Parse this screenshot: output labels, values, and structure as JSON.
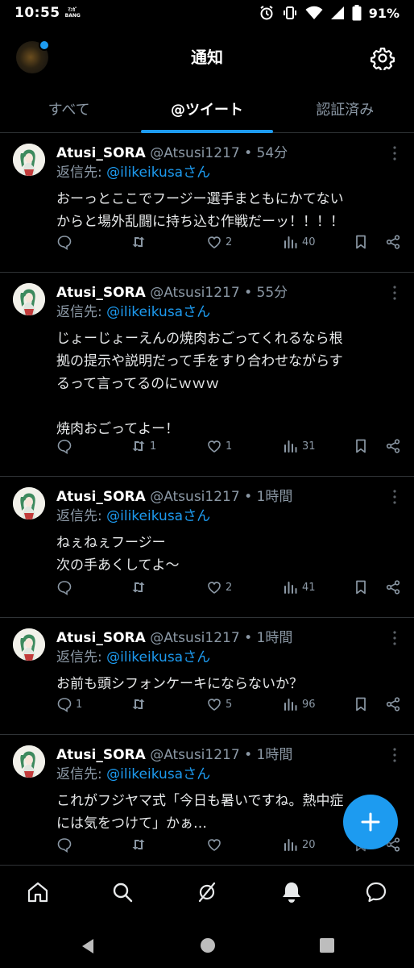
{
  "status_bar": {
    "time": "10:55",
    "carrier_line1": "ﾏﾝｶﾞ",
    "carrier_line2": "BANG",
    "battery": "91%"
  },
  "header": {
    "title": "通知"
  },
  "tabs": [
    {
      "label": "すべて",
      "active": false
    },
    {
      "label": "@ツイート",
      "active": true
    },
    {
      "label": "認証済み",
      "active": false
    }
  ],
  "tweets": [
    {
      "name": "Atusi_SORA",
      "handle": "@Atsusi1217",
      "sep": "•",
      "time": "54分",
      "reply_prefix": "返信先: ",
      "reply_to": "@ilikeikusaさん",
      "text": "おーっとここでフージー選手まともにかてない\nからと場外乱闘に持ち込む作戦だーッ！！！！",
      "replies": "",
      "retweets": "",
      "likes": "2",
      "views": "40"
    },
    {
      "name": "Atusi_SORA",
      "handle": "@Atsusi1217",
      "sep": "•",
      "time": "55分",
      "reply_prefix": "返信先: ",
      "reply_to": "@ilikeikusaさん",
      "text": "じょーじょーえんの焼肉おごってくれるなら根\n拠の提示や説明だって手をすり合わせながらす\nるって言ってるのにｗｗｗ\n\n焼肉おごってよー！",
      "replies": "",
      "retweets": "1",
      "likes": "1",
      "views": "31"
    },
    {
      "name": "Atusi_SORA",
      "handle": "@Atsusi1217",
      "sep": "•",
      "time": "1時間",
      "reply_prefix": "返信先: ",
      "reply_to": "@ilikeikusaさん",
      "text": "ねぇねぇフージー\n次の手あくしてよ〜",
      "replies": "",
      "retweets": "",
      "likes": "2",
      "views": "41"
    },
    {
      "name": "Atusi_SORA",
      "handle": "@Atsusi1217",
      "sep": "•",
      "time": "1時間",
      "reply_prefix": "返信先: ",
      "reply_to": "@ilikeikusaさん",
      "text": "お前も頭シフォンケーキにならないか？",
      "replies": "1",
      "retweets": "",
      "likes": "5",
      "views": "96"
    },
    {
      "name": "Atusi_SORA",
      "handle": "@Atsusi1217",
      "sep": "•",
      "time": "1時間",
      "reply_prefix": "返信先: ",
      "reply_to": "@ilikeikusaさん",
      "text": "これがフジヤマ式「今日も暑いですね。熱中症\nには気をつけて」かぁ…",
      "replies": "",
      "retweets": "",
      "likes": "",
      "views": "20"
    }
  ],
  "icons": {
    "header": [
      "avatar",
      "gear-icon"
    ],
    "tweet_actions": [
      "reply-icon",
      "retweet-icon",
      "like-icon",
      "views-icon",
      "bookmark-icon",
      "share-icon"
    ],
    "bottom_nav": [
      "home-icon",
      "search-icon",
      "communities-icon",
      "notifications-icon",
      "messages-icon"
    ],
    "fab": "plus-icon",
    "system_nav": [
      "back-icon",
      "home-circle-icon",
      "recents-icon"
    ]
  },
  "colors": {
    "accent": "#1d9bf0",
    "background": "#000000",
    "muted": "#8b98a5"
  }
}
